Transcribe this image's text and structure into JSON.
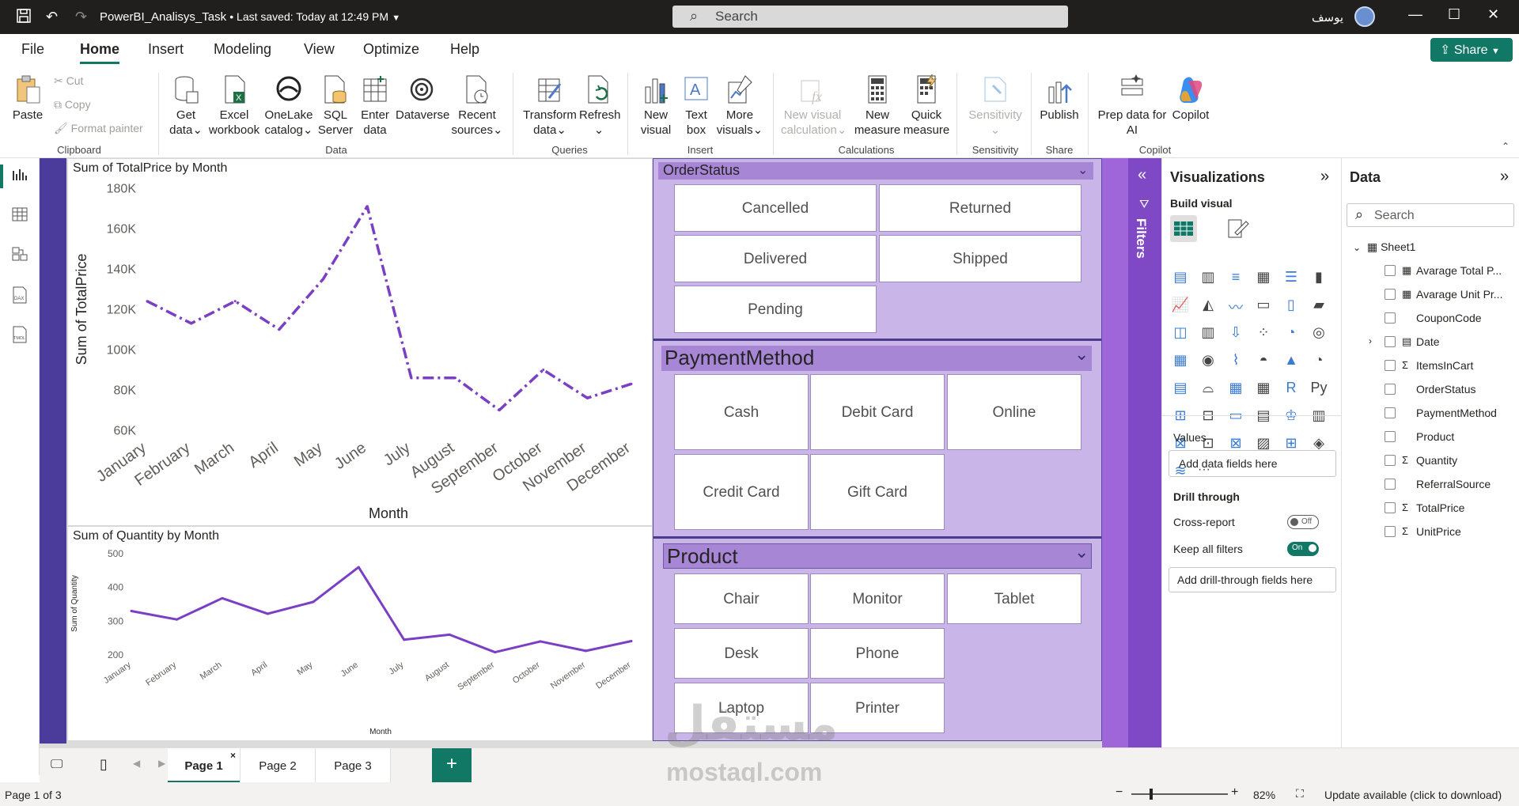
{
  "titlebar": {
    "filename": "PowerBI_Analisys_Task",
    "saved": "• Last saved: Today at 12:49 PM",
    "search_placeholder": "Search",
    "user": "يوسف"
  },
  "menu": {
    "items": [
      "File",
      "Home",
      "Insert",
      "Modeling",
      "View",
      "Optimize",
      "Help"
    ],
    "share": "Share"
  },
  "ribbon": {
    "paste": "Paste",
    "cut": "Cut",
    "copy": "Copy",
    "format_painter": "Format painter",
    "get_data": [
      "Get",
      "data"
    ],
    "excel": [
      "Excel",
      "workbook"
    ],
    "onelake": [
      "OneLake",
      "catalog"
    ],
    "sql": [
      "SQL",
      "Server"
    ],
    "enter": [
      "Enter",
      "data"
    ],
    "dataverse": "Dataverse",
    "recent": [
      "Recent",
      "sources"
    ],
    "transform": [
      "Transform",
      "data"
    ],
    "refresh": "Refresh",
    "new_visual": [
      "New",
      "visual"
    ],
    "text_box": [
      "Text",
      "box"
    ],
    "more_visuals": [
      "More",
      "visuals"
    ],
    "new_visual_calc": [
      "New visual",
      "calculation"
    ],
    "new_measure": [
      "New",
      "measure"
    ],
    "quick_measure": [
      "Quick",
      "measure"
    ],
    "sensitivity": "Sensitivity",
    "publish": "Publish",
    "prep_data": [
      "Prep data for",
      "AI"
    ],
    "copilot": "Copilot",
    "groups": {
      "clipboard": "Clipboard",
      "data": "Data",
      "queries": "Queries",
      "insert": "Insert",
      "calculations": "Calculations",
      "sensitivity": "Sensitivity",
      "share": "Share",
      "copilot": "Copilot"
    }
  },
  "chart_data": [
    {
      "type": "line",
      "title": "Sum of TotalPrice by Month",
      "xlabel": "Month",
      "ylabel": "Sum of TotalPrice",
      "categories": [
        "January",
        "February",
        "March",
        "April",
        "May",
        "June",
        "July",
        "August",
        "September",
        "October",
        "November",
        "December"
      ],
      "values": [
        124000,
        113000,
        124000,
        110000,
        135000,
        171000,
        86000,
        86000,
        70000,
        90000,
        76000,
        83000
      ],
      "ylim": [
        60000,
        180000
      ],
      "yticks": [
        "60K",
        "80K",
        "100K",
        "120K",
        "140K",
        "160K",
        "180K"
      ],
      "line_style": "dash-dot",
      "color": "#7b3fc4"
    },
    {
      "type": "line",
      "title": "Sum of Quantity by Month",
      "xlabel": "Month",
      "ylabel": "Sum of Quantity",
      "categories": [
        "January",
        "February",
        "March",
        "April",
        "May",
        "June",
        "July",
        "August",
        "September",
        "October",
        "November",
        "December"
      ],
      "values": [
        330,
        305,
        368,
        322,
        357,
        460,
        245,
        260,
        208,
        240,
        212,
        241
      ],
      "ylim": [
        200,
        500
      ],
      "yticks": [
        "200",
        "300",
        "400",
        "500"
      ],
      "color": "#7b3fc4"
    }
  ],
  "slicers": {
    "order_status": {
      "title": "OrderStatus",
      "items": [
        "Cancelled",
        "Returned",
        "Delivered",
        "Shipped",
        "Pending"
      ]
    },
    "payment_method": {
      "title": "PaymentMethod",
      "items": [
        "Cash",
        "Debit Card",
        "Online",
        "Credit Card",
        "Gift Card"
      ]
    },
    "product": {
      "title": "Product",
      "items": [
        "Chair",
        "Monitor",
        "Tablet",
        "Desk",
        "Phone",
        "Laptop",
        "Printer"
      ]
    }
  },
  "filters_label": "Filters",
  "viz": {
    "title": "Visualizations",
    "build_visual": "Build visual",
    "values": "Values",
    "add_fields": "Add data fields here",
    "drill_through": "Drill through",
    "cross_report": "Cross-report",
    "cross_report_state": "Off",
    "keep_filters": "Keep all filters",
    "keep_filters_state": "On",
    "add_drill": "Add drill-through fields here",
    "more": "···",
    "r": "R",
    "py": "Py"
  },
  "data_pane": {
    "title": "Data",
    "search_placeholder": "Search",
    "table": "Sheet1",
    "fields": [
      {
        "name": "Avarage Total P...",
        "icon": "calc"
      },
      {
        "name": "Avarage Unit Pr...",
        "icon": "calc"
      },
      {
        "name": "CouponCode",
        "icon": ""
      },
      {
        "name": "Date",
        "icon": "table",
        "expand": true
      },
      {
        "name": "ItemsInCart",
        "icon": "sigma"
      },
      {
        "name": "OrderStatus",
        "icon": ""
      },
      {
        "name": "PaymentMethod",
        "icon": ""
      },
      {
        "name": "Product",
        "icon": ""
      },
      {
        "name": "Quantity",
        "icon": "sigma"
      },
      {
        "name": "ReferralSource",
        "icon": ""
      },
      {
        "name": "TotalPrice",
        "icon": "sigma"
      },
      {
        "name": "UnitPrice",
        "icon": "sigma"
      }
    ]
  },
  "pages": [
    "Page 1",
    "Page 2",
    "Page 3"
  ],
  "add_page": "+",
  "status": {
    "page": "Page 1 of 3",
    "zoom": "82%",
    "update": "Update available (click to download)"
  },
  "watermark": {
    "arabic": "مستقل",
    "latin": "mostaql.com"
  }
}
